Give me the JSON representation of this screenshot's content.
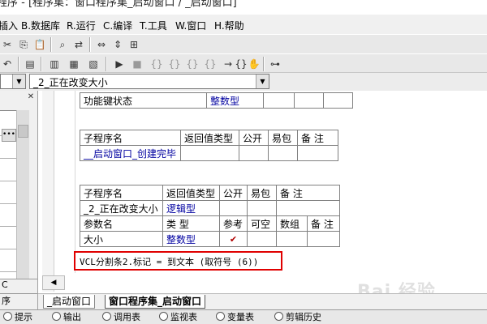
{
  "window": {
    "title": "程序 - [程序集：窗口程序集_启动窗口 / _启动窗口]"
  },
  "menu": [
    "插入",
    "B.数据库",
    "R.运行",
    "C.编译",
    "T.工具",
    "W.窗口",
    "H.帮助"
  ],
  "combo": {
    "left_value": "",
    "right_value": "_2_正在改变大小"
  },
  "left_panel": {
    "bottom_label_1": "C",
    "bottom_label_2": "序"
  },
  "tables": {
    "t0": {
      "name": "功能键状态",
      "type": "整数型"
    },
    "t1": {
      "headers": [
        "子程序名",
        "返回值类型",
        "公开",
        "易包",
        "备 注"
      ],
      "row": [
        "__启动窗口_创建完毕",
        "",
        "",
        "",
        ""
      ]
    },
    "t2": {
      "headers": [
        "子程序名",
        "返回值类型",
        "公开",
        "易包",
        "备 注"
      ],
      "row": [
        "_2_正在改变大小",
        "逻辑型",
        "",
        "",
        ""
      ],
      "param_headers": [
        "参数名",
        "类 型",
        "参考",
        "可空",
        "数组",
        "备 注"
      ],
      "param_row": [
        "大小",
        "整数型",
        "✔",
        "",
        "",
        ""
      ]
    }
  },
  "code_line": "VCL分割条2.标记 = 到文本 (取符号 (6))",
  "bottom_tabs": [
    "_启动窗口",
    "窗口程序集_启动窗口"
  ],
  "status_tabs": [
    "提示",
    "输出",
    "调用表",
    "监视表",
    "变量表",
    "剪辑历史"
  ],
  "watermark": "Bai 经验",
  "colors": {
    "highlight_border": "#e00000",
    "type_text": "#0000a0",
    "check": "#b00000"
  }
}
